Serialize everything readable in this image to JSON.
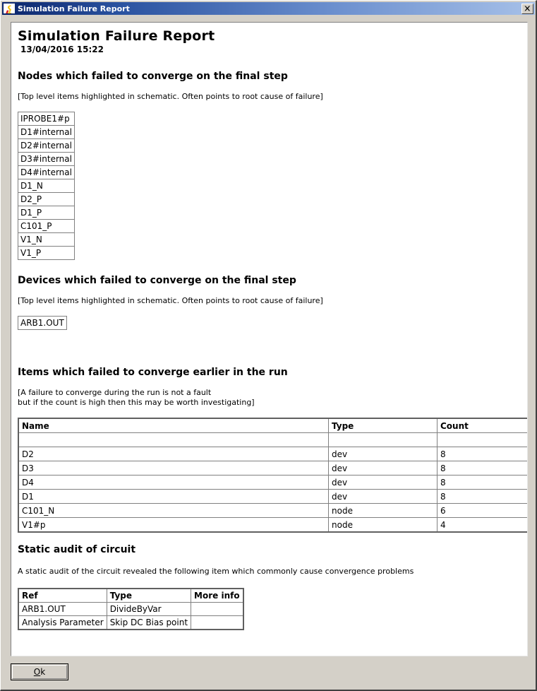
{
  "window": {
    "title": "Simulation Failure Report",
    "icon": "simetrix-logo-icon",
    "close_label": "close-icon"
  },
  "report": {
    "title": "Simulation Failure Report",
    "date": "13/04/2016 15:22",
    "nodes_section": {
      "heading": "Nodes which failed to converge on the final step",
      "note": "[Top level items highlighted in schematic. Often points to root cause of failure]",
      "items": [
        "IPROBE1#p",
        "D1#internal",
        "D2#internal",
        "D3#internal",
        "D4#internal",
        "D1_N",
        "D2_P",
        "D1_P",
        "C101_P",
        "V1_N",
        "V1_P"
      ]
    },
    "devices_section": {
      "heading": "Devices which failed to converge on the final step",
      "note": "[Top level items highlighted in schematic. Often points to root cause of failure]",
      "items": [
        "ARB1.OUT"
      ]
    },
    "earlier_section": {
      "heading": "Items which failed to converge earlier in the run",
      "note_line1": "[A failure to converge during the run is not a fault",
      "note_line2": "but if the count is high then this may be worth investigating]",
      "columns": [
        "Name",
        "Type",
        "Count"
      ],
      "rows": [
        {
          "name": "",
          "type": "",
          "count": ""
        },
        {
          "name": "D2",
          "type": "dev",
          "count": "8"
        },
        {
          "name": "D3",
          "type": "dev",
          "count": "8"
        },
        {
          "name": "D4",
          "type": "dev",
          "count": "8"
        },
        {
          "name": "D1",
          "type": "dev",
          "count": "8"
        },
        {
          "name": "C101_N",
          "type": "node",
          "count": "6"
        },
        {
          "name": "V1#p",
          "type": "node",
          "count": "4"
        }
      ]
    },
    "audit_section": {
      "heading": "Static audit of circuit",
      "note": "A static audit of the circuit revealed the following item which commonly cause convergence problems",
      "columns": [
        "Ref",
        "Type",
        "More info"
      ],
      "rows": [
        {
          "ref": "ARB1.OUT",
          "type": "DivideByVar",
          "more": ""
        },
        {
          "ref": "Analysis Parameter",
          "type": "Skip DC Bias point",
          "more": ""
        }
      ]
    }
  },
  "footer": {
    "ok_accel": "O",
    "ok_rest": "k"
  },
  "colors": {
    "titlebar_start": "#0a246a",
    "titlebar_end": "#a6c0e8",
    "dialog_bg": "#d4d0c8",
    "panel_bg": "#ffffff",
    "border_gray": "#808080"
  }
}
